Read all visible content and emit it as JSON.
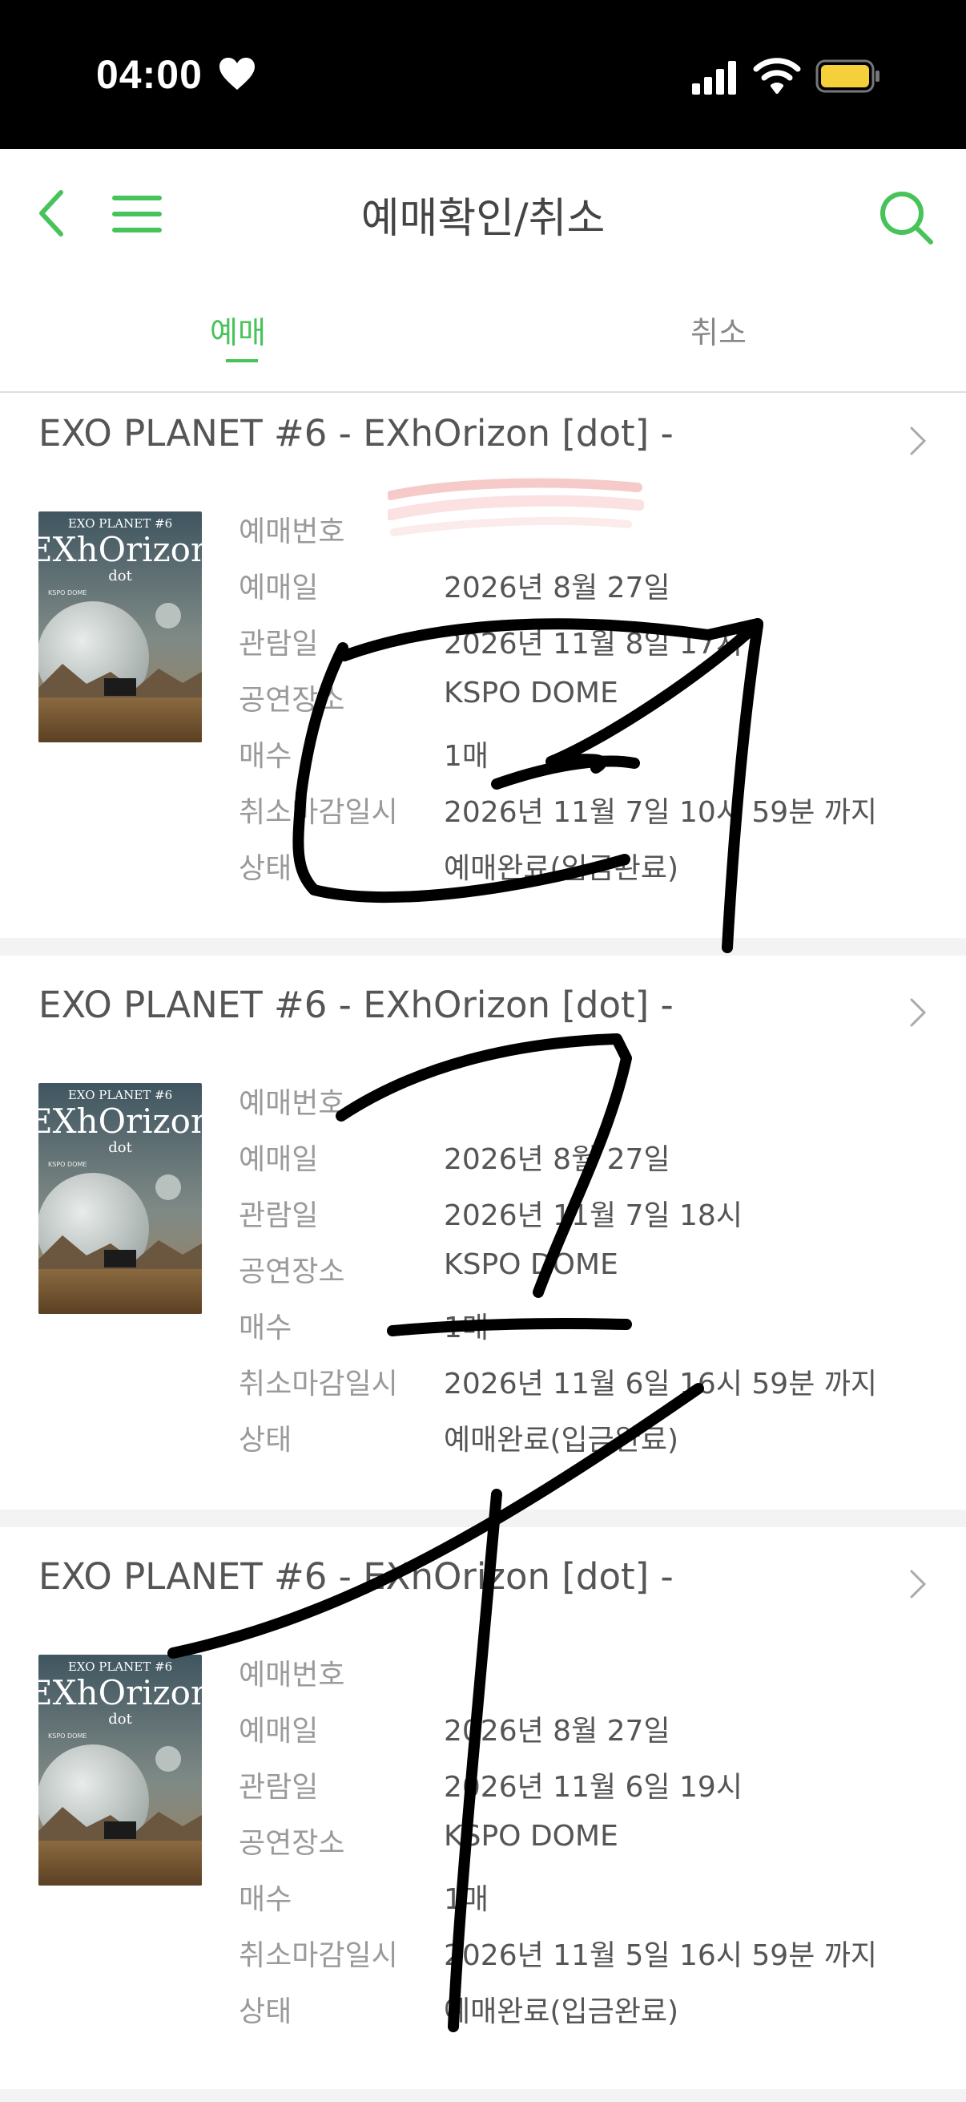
{
  "status_bar": {
    "time": "04:00"
  },
  "header": {
    "title": "예매확인/취소"
  },
  "tabs": [
    {
      "label": "예매",
      "active": true
    },
    {
      "label": "취소",
      "active": false
    }
  ],
  "colors": {
    "accent": "#48c35a",
    "title_text": "#444444",
    "label_text": "#9a9a9a",
    "value_text": "#555555"
  },
  "icons": [
    "heart-icon",
    "cellular-signal-icon",
    "wifi-icon",
    "battery-icon",
    "back-chevron-icon",
    "hamburger-menu-icon",
    "search-icon",
    "chevron-right-icon"
  ],
  "poster": {
    "title": "EXO PLANET #6",
    "logo": "EXhOrizon",
    "sub": "dot",
    "venue": "KSPO DOME"
  },
  "labels": {
    "booking_no": "예매번호",
    "booking_date": "예매일",
    "view_date": "관람일",
    "venue": "공연장소",
    "count": "매수",
    "cancel_deadline": "취소마감일시",
    "status": "상태"
  },
  "bookings": [
    {
      "title": "EXO PLANET #6 - EXhOrizon [dot] -",
      "booking_no": "",
      "booking_date": "2026년 8월 27일",
      "view_date": "2026년 11월 8일 17시",
      "venue": "KSPO DOME",
      "count": "1매",
      "cancel_deadline": "2026년 11월 7일 10시 59분 까지",
      "status": "예매완료(입금완료)"
    },
    {
      "title": "EXO PLANET #6 - EXhOrizon [dot] -",
      "booking_no": "",
      "booking_date": "2026년 8월 27일",
      "view_date": "2026년 11월 7일 18시",
      "venue": "KSPO DOME",
      "count": "1매",
      "cancel_deadline": "2026년 11월 6일 16시 59분 까지",
      "status": "예매완료(입금완료)"
    },
    {
      "title": "EXO PLANET #6 - EXhOrizon [dot] -",
      "booking_no": "",
      "booking_date": "2026년 8월 27일",
      "view_date": "2026년 11월 6일 19시",
      "venue": "KSPO DOME",
      "count": "1매",
      "cancel_deadline": "2026년 11월 5일 16시 59분 까지",
      "status": "예매완료(입금완료)"
    }
  ]
}
